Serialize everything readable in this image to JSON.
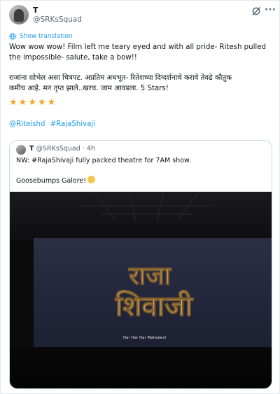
{
  "tweet": {
    "author_name": "T",
    "author_handle": "@SRKsSquad",
    "show_translation": "Show translation",
    "text_line1": "Wow wow wow! Film left me teary eyed and with all pride- Ritesh pulled",
    "text_line2": "the impossible- salute, take a bow!!",
    "marathi_line1": "राजांना शोभेल असा चित्रपट. अप्रतिम अधभूत- रितेशच्या दिग्दर्शनाचे करावे तेवढे कौतुक",
    "marathi_line2": "कमीच आहे. मन तृप्त झाले..खरच. जाम आवडला. 5 Stars!",
    "star_count": 5,
    "mention": "@Riteishd",
    "hashtag": "#RajaShivaji"
  },
  "quote": {
    "display_name": "T",
    "handle": "@SRKsSquad",
    "time": "· 4h",
    "text_line1": "NW: #RajaShivaji fully packed theatre for 7AM show.",
    "text_line2": "Goosebumps Galore!",
    "media": {
      "title_line1": "राजा",
      "title_line2": "शिवाजी",
      "subtitle": "Har Har Har Mahadev!"
    }
  },
  "icons": {
    "grok": "grok-icon",
    "more": "more-icon",
    "translate": "translate-globe-icon",
    "star": "star-emoji-icon",
    "smile": "smiling-face-emoji-icon"
  },
  "colors": {
    "link": "#1d9bf0",
    "secondary_text": "#536471",
    "star": "#f4a51c",
    "title_gold": "#d9b46a"
  }
}
